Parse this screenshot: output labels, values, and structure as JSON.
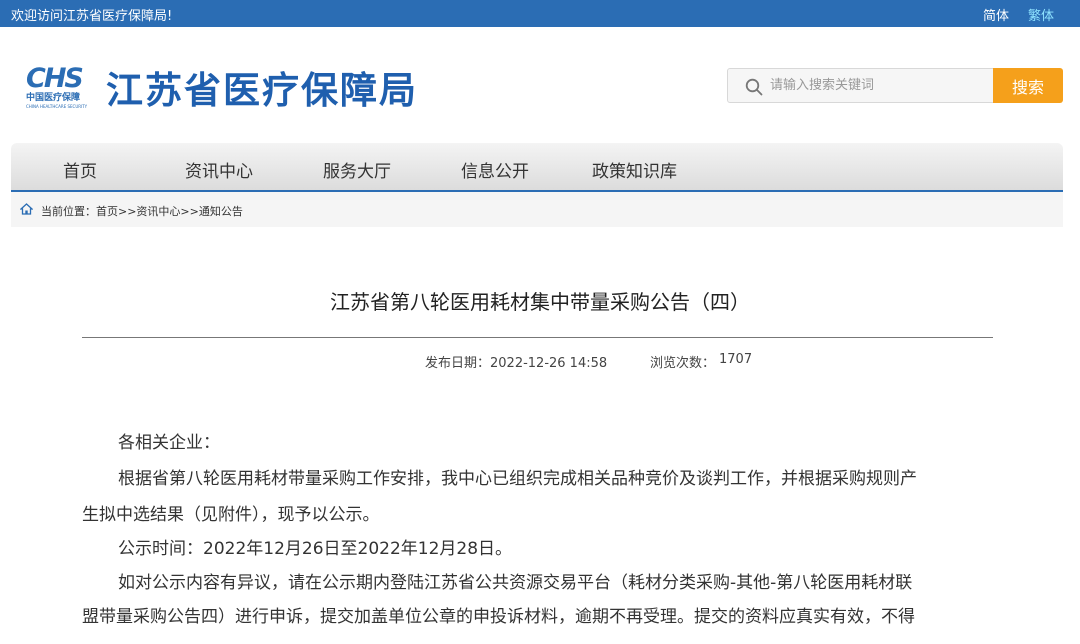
{
  "topbar": {
    "welcome": "欢迎访问江苏省医疗保障局!",
    "lang_simplified": "简体",
    "lang_traditional": "繁体"
  },
  "header": {
    "logo_mark": "CHS",
    "logo_cn": "中国医疗保障",
    "logo_en": "CHINA HEALTHCARE SECURITY",
    "site_title": "江苏省医疗保障局",
    "search_placeholder": "请输入搜索关键词",
    "search_button": "搜索"
  },
  "nav": {
    "items": [
      "首页",
      "资讯中心",
      "服务大厅",
      "信息公开",
      "政策知识库"
    ]
  },
  "breadcrumb": {
    "text": "当前位置：首页>>资讯中心>>通知公告"
  },
  "article": {
    "title": "江苏省第八轮医用耗材集中带量采购公告（四）",
    "publish_label": "发布日期：2022-12-26 14:58",
    "views_label": "浏览次数：",
    "views": "1707",
    "lines": [
      "各相关企业：",
      "根据省第八轮医用耗材带量采购工作安排，我中心已组织完成相关品种竞价及谈判工作，并根据采购规则产",
      "生拟中选结果（见附件），现予以公示。",
      "公示时间：2022年12月26日至2022年12月28日。",
      "如对公示内容有异议，请在公示期内登陆江苏省公共资源交易平台（耗材分类采购-其他-第八轮医用耗材联",
      "盟带量采购公告四）进行申诉，提交加盖单位公章的申投诉材料，逾期不再受理。提交的资料应真实有效，不得"
    ]
  },
  "colors": {
    "brand_blue": "#2b6db4",
    "search_orange": "#f5a01b",
    "trad_link": "#8fe3ff"
  }
}
